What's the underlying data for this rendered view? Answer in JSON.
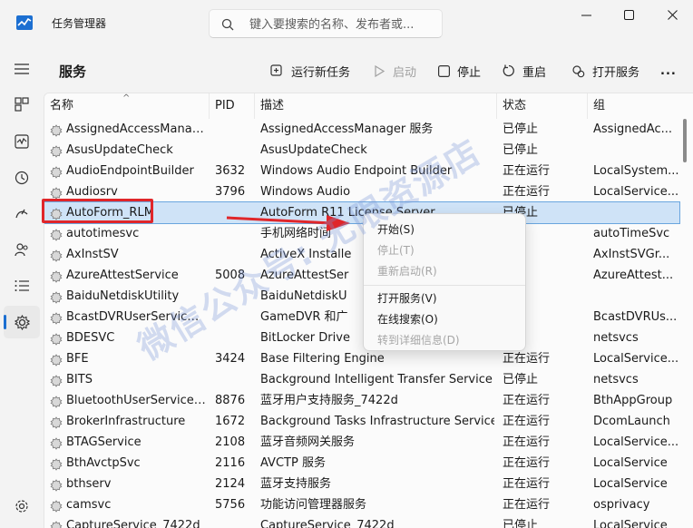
{
  "window": {
    "title": "任务管理器",
    "search_placeholder": "键入要搜索的名称、发布者或..."
  },
  "nav": {
    "items": [
      {
        "icon": "hamburger-menu-icon"
      },
      {
        "icon": "processes-icon"
      },
      {
        "icon": "performance-icon"
      },
      {
        "icon": "app-history-icon"
      },
      {
        "icon": "startup-apps-icon"
      },
      {
        "icon": "users-icon"
      },
      {
        "icon": "details-icon"
      },
      {
        "icon": "services-icon",
        "active": true
      },
      {
        "icon": "settings-icon"
      }
    ]
  },
  "page": {
    "title": "服务",
    "commands": {
      "run_new_task": "运行新任务",
      "start": "启动",
      "stop": "停止",
      "restart": "重启",
      "open_services": "打开服务",
      "more": "..."
    }
  },
  "table": {
    "headers": {
      "name": "名称",
      "pid": "PID",
      "desc": "描述",
      "status": "状态",
      "group": "组"
    },
    "rows": [
      {
        "name": "AssignedAccessManag...",
        "pid": "",
        "desc": "AssignedAccessManager 服务",
        "status": "已停止",
        "group": "AssignedAc..."
      },
      {
        "name": "AsusUpdateCheck",
        "pid": "",
        "desc": "AsusUpdateCheck",
        "status": "已停止",
        "group": ""
      },
      {
        "name": "AudioEndpointBuilder",
        "pid": "3632",
        "desc": "Windows Audio Endpoint Builder",
        "status": "正在运行",
        "group": "LocalSystem..."
      },
      {
        "name": "Audiosrv",
        "pid": "3796",
        "desc": "Windows Audio",
        "status": "正在运行",
        "group": "LocalService..."
      },
      {
        "name": "AutoForm_RLM",
        "pid": "",
        "desc": "AutoForm R11 License Server",
        "status": "已停止",
        "group": "",
        "selected": true
      },
      {
        "name": "autotimesvc",
        "pid": "",
        "desc": "手机网络时间",
        "status": "",
        "group": "autoTimeSvc"
      },
      {
        "name": "AxInstSV",
        "pid": "",
        "desc": "ActiveX Installe",
        "status": "",
        "group": "AxInstSVGr..."
      },
      {
        "name": "AzureAttestService",
        "pid": "5008",
        "desc": "AzureAttestSer",
        "status": "",
        "group": "AzureAttest..."
      },
      {
        "name": "BaiduNetdiskUtility",
        "pid": "",
        "desc": "BaiduNetdiskU",
        "status": "",
        "group": ""
      },
      {
        "name": "BcastDVRUserService_...",
        "pid": "",
        "desc": "GameDVR 和广",
        "status": "",
        "group": "BcastDVRUs..."
      },
      {
        "name": "BDESVC",
        "pid": "",
        "desc": "BitLocker Drive",
        "status": "",
        "group": "netsvcs"
      },
      {
        "name": "BFE",
        "pid": "3424",
        "desc": "Base Filtering Engine",
        "status": "正在运行",
        "group": "LocalService..."
      },
      {
        "name": "BITS",
        "pid": "",
        "desc": "Background Intelligent Transfer Service",
        "status": "已停止",
        "group": "netsvcs"
      },
      {
        "name": "BluetoothUserService_...",
        "pid": "8876",
        "desc": "蓝牙用户支持服务_7422d",
        "status": "正在运行",
        "group": "BthAppGroup"
      },
      {
        "name": "BrokerInfrastructure",
        "pid": "1672",
        "desc": "Background Tasks Infrastructure Service",
        "status": "正在运行",
        "group": "DcomLaunch"
      },
      {
        "name": "BTAGService",
        "pid": "2108",
        "desc": "蓝牙音频网关服务",
        "status": "正在运行",
        "group": "LocalService..."
      },
      {
        "name": "BthAvctpSvc",
        "pid": "2116",
        "desc": "AVCTP 服务",
        "status": "正在运行",
        "group": "LocalService"
      },
      {
        "name": "bthserv",
        "pid": "2124",
        "desc": "蓝牙支持服务",
        "status": "正在运行",
        "group": "LocalService"
      },
      {
        "name": "camsvc",
        "pid": "5756",
        "desc": "功能访问管理器服务",
        "status": "正在运行",
        "group": "osprivacy"
      },
      {
        "name": "CaptureService_7422d",
        "pid": "",
        "desc": "CaptureService_7422d",
        "status": "已停止",
        "group": "LocalService"
      }
    ]
  },
  "context_menu": {
    "items": [
      {
        "label": "开始(S)",
        "enabled": true
      },
      {
        "label": "停止(T)",
        "enabled": false
      },
      {
        "label": "重新启动(R)",
        "enabled": false
      },
      {
        "label": "打开服务(V)",
        "enabled": true
      },
      {
        "label": "在线搜索(O)",
        "enabled": true
      },
      {
        "label": "转到详细信息(D)",
        "enabled": false
      }
    ]
  },
  "watermark": "微信公众号: 无限资源店",
  "colors": {
    "accent": "#1c6fd1",
    "annotation_red": "#e0262a",
    "selection": "#cfe3f7"
  }
}
